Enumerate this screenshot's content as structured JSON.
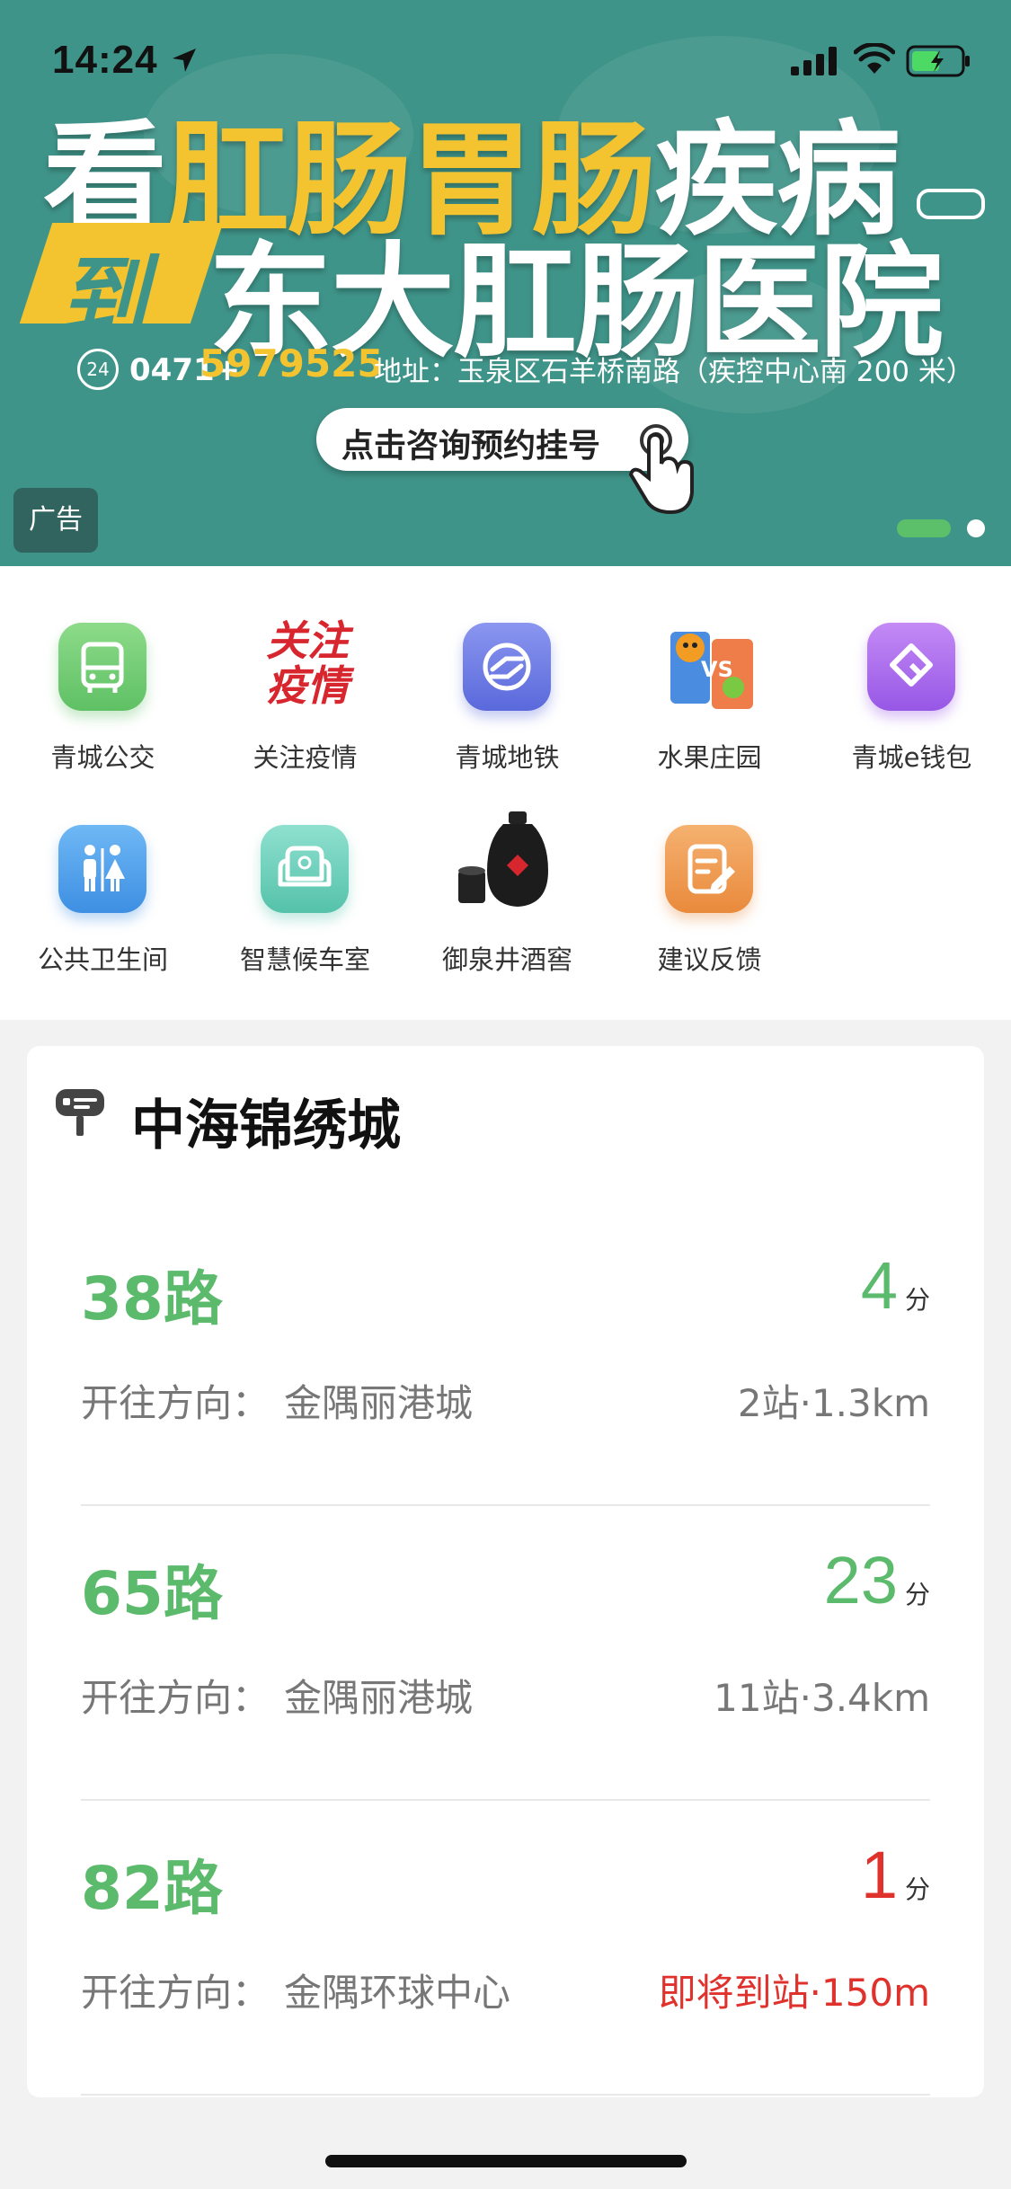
{
  "status_bar": {
    "time": "14:24"
  },
  "banner": {
    "headline1_prefix": "看",
    "headline1_highlight": "肛肠胃肠",
    "headline1_suffix": "疾病",
    "headline2_badge": "到",
    "headline2": "东大肛肠医院",
    "phone_prefix": "0471+",
    "phone_number": "5979525",
    "address": "地址：玉泉区石羊桥南路（疾控中心南 200 米）",
    "cta_label": "点击咨询预约挂号",
    "ad_tag": "广告",
    "colors": {
      "background": "#3f9489",
      "highlight": "#f4c430"
    }
  },
  "shortcuts": [
    {
      "label": "青城公交",
      "icon": "bus-icon"
    },
    {
      "label": "关注疫情",
      "icon": "epidemic-icon",
      "icon_text": "关注疫情"
    },
    {
      "label": "青城地铁",
      "icon": "metro-icon"
    },
    {
      "label": "水果庄园",
      "icon": "fruit-farm-icon"
    },
    {
      "label": "青城e钱包",
      "icon": "wallet-icon"
    },
    {
      "label": "公共卫生间",
      "icon": "toilet-icon"
    },
    {
      "label": "智慧候车室",
      "icon": "waiting-room-icon"
    },
    {
      "label": "御泉井酒窖",
      "icon": "wine-jar-icon"
    },
    {
      "label": "建议反馈",
      "icon": "feedback-icon"
    }
  ],
  "station": {
    "name": "中海锦绣城",
    "direction_label": "开往方向：",
    "routes": [
      {
        "name": "38路",
        "eta": "4",
        "eta_unit": "分",
        "direction": "金隅丽港城",
        "distance": "2站·1.3km",
        "status": "normal"
      },
      {
        "name": "65路",
        "eta": "23",
        "eta_unit": "分",
        "direction": "金隅丽港城",
        "distance": "11站·3.4km",
        "status": "normal"
      },
      {
        "name": "82路",
        "eta": "1",
        "eta_unit": "分",
        "direction": "金隅环球中心",
        "distance": "即将到站·150m",
        "status": "arriving"
      }
    ],
    "colors": {
      "route": "#5cba6c",
      "arriving": "#e0322d"
    }
  }
}
